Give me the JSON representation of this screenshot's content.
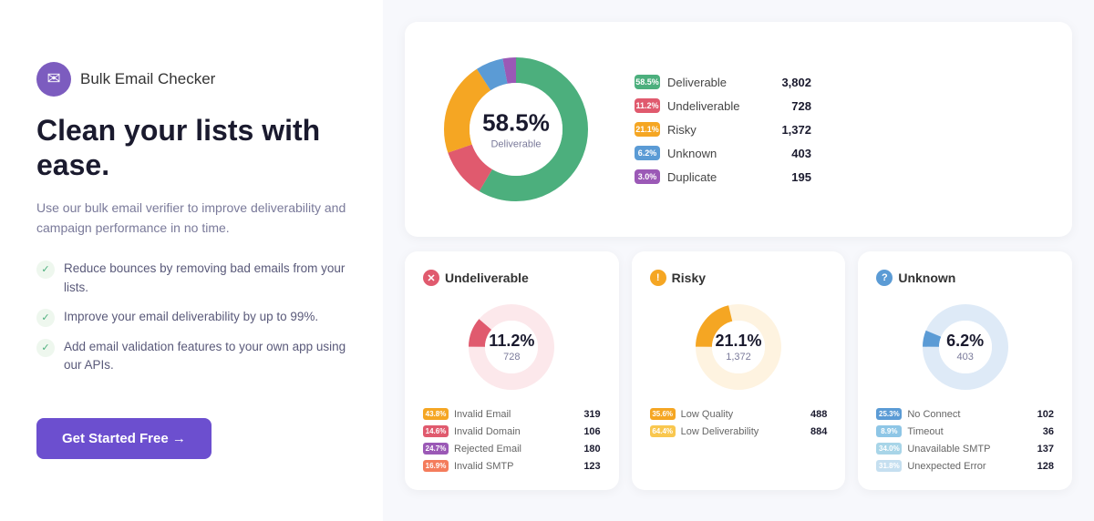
{
  "left": {
    "brand_icon": "✉",
    "brand_name": "Bulk Email Checker",
    "headline": "Clean your lists with ease.",
    "subtext": "Use our bulk email verifier to improve deliverability and campaign performance in no time.",
    "features": [
      "Reduce bounces by removing bad emails from your lists.",
      "Improve your email deliverability by up to 99%.",
      "Add email validation features to your own app using our APIs."
    ],
    "cta_label": "Get Started Free →"
  },
  "top_chart": {
    "center_pct": "58.5%",
    "center_label": "Deliverable",
    "legend": [
      {
        "color": "#4caf7d",
        "pct_label": "58.5%",
        "name": "Deliverable",
        "count": "3,802"
      },
      {
        "color": "#e05a6e",
        "pct_label": "11.2%",
        "name": "Undeliverable",
        "count": "728"
      },
      {
        "color": "#f5a623",
        "pct_label": "21.1%",
        "name": "Risky",
        "count": "1,372"
      },
      {
        "color": "#5b9bd5",
        "pct_label": "6.2%",
        "name": "Unknown",
        "count": "403"
      },
      {
        "color": "#9b59b6",
        "pct_label": "3.0%",
        "name": "Duplicate",
        "count": "195"
      }
    ],
    "donut_segments": [
      {
        "color": "#4caf7d",
        "pct": 58.5
      },
      {
        "color": "#e05a6e",
        "pct": 11.2
      },
      {
        "color": "#f5a623",
        "pct": 21.1
      },
      {
        "color": "#5b9bd5",
        "pct": 6.2
      },
      {
        "color": "#9b59b6",
        "pct": 3.0
      }
    ]
  },
  "sub_cards": [
    {
      "title": "Undeliverable",
      "title_icon_color": "#e05a6e",
      "title_icon": "✕",
      "center_pct": "11.2%",
      "center_count": "728",
      "donut_color_main": "#e05a6e",
      "donut_color_bg": "#fce8eb",
      "legend": [
        {
          "color": "#f5a623",
          "pct_label": "43.8%",
          "name": "Invalid Email",
          "count": "319"
        },
        {
          "color": "#e05a6e",
          "pct_label": "14.6%",
          "name": "Invalid Domain",
          "count": "106"
        },
        {
          "color": "#9b59b6",
          "pct_label": "24.7%",
          "name": "Rejected Email",
          "count": "180"
        },
        {
          "color": "#f47c5c",
          "pct_label": "16.9%",
          "name": "Invalid SMTP",
          "count": "123"
        }
      ]
    },
    {
      "title": "Risky",
      "title_icon_color": "#f5a623",
      "title_icon": "!",
      "center_pct": "21.1%",
      "center_count": "1,372",
      "donut_color_main": "#f5a623",
      "donut_color_bg": "#fef3e0",
      "legend": [
        {
          "color": "#f5a623",
          "pct_label": "35.6%",
          "name": "Low Quality",
          "count": "488"
        },
        {
          "color": "#f9c74f",
          "pct_label": "64.4%",
          "name": "Low Deliverability",
          "count": "884"
        }
      ]
    },
    {
      "title": "Unknown",
      "title_icon_color": "#5b9bd5",
      "title_icon": "?",
      "center_pct": "6.2%",
      "center_count": "403",
      "donut_color_main": "#5b9bd5",
      "donut_color_bg": "#deeaf7",
      "legend": [
        {
          "color": "#5b9bd5",
          "pct_label": "25.3%",
          "name": "No Connect",
          "count": "102"
        },
        {
          "color": "#8ec6e6",
          "pct_label": "8.9%",
          "name": "Timeout",
          "count": "36"
        },
        {
          "color": "#a8d5e8",
          "pct_label": "34.0%",
          "name": "Unavailable SMTP",
          "count": "137"
        },
        {
          "color": "#c5dff0",
          "pct_label": "31.8%",
          "name": "Unexpected Error",
          "count": "128"
        }
      ]
    }
  ]
}
